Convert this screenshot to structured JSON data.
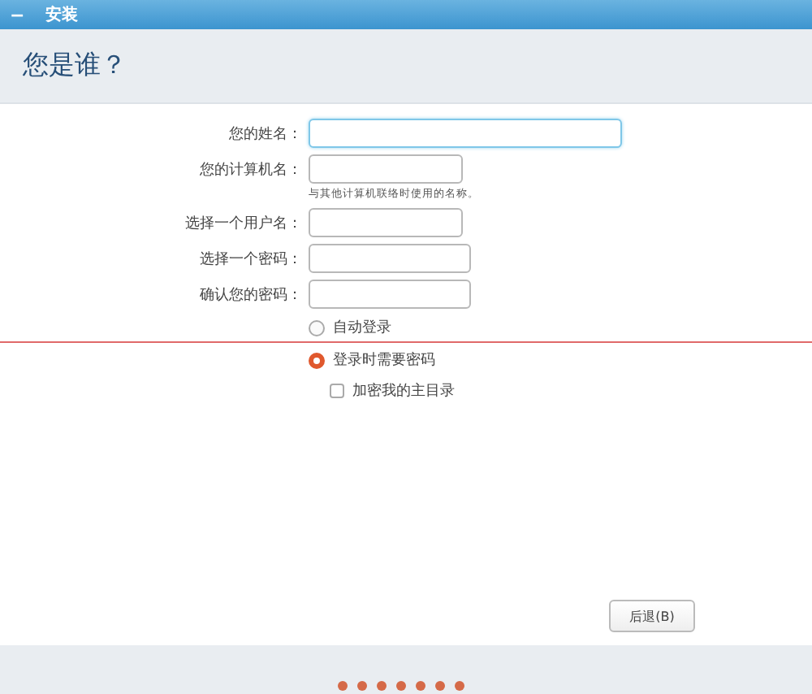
{
  "window": {
    "title": "安装",
    "menu_glyph": "−"
  },
  "header": {
    "title": "您是谁？"
  },
  "fields": [
    {
      "label": "您的姓名：",
      "focused": true
    },
    {
      "label": "您的计算机名：",
      "focused": false,
      "hint": "与其他计算机联络时使用的名称。"
    },
    {
      "label": "选择一个用户名：",
      "focused": false
    },
    {
      "label": "选择一个密码：",
      "focused": false
    },
    {
      "label": "确认您的密码：",
      "focused": false
    }
  ],
  "login_options": [
    {
      "kind": "radio",
      "label": "自动登录",
      "selected": false
    },
    {
      "kind": "radio",
      "label": "登录时需要密码",
      "selected": true
    },
    {
      "kind": "checkbox",
      "label": "加密我的主目录",
      "checked": false
    }
  ],
  "buttons": [
    {
      "label": "后退(B)"
    }
  ],
  "progress": {
    "steps": [
      {
        "done": true
      },
      {
        "done": true
      },
      {
        "done": true
      },
      {
        "done": true
      },
      {
        "done": true
      },
      {
        "done": true
      },
      {
        "done": true
      }
    ]
  }
}
